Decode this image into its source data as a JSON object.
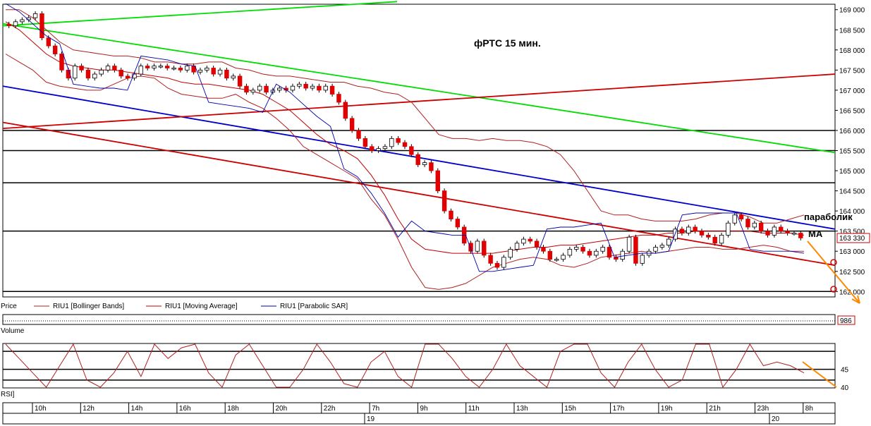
{
  "chart_data": {
    "type": "candlestick",
    "title": "фРТС   15 мин.",
    "price_axis": {
      "ylim": [
        161900,
        169100
      ],
      "ticks": [
        169000,
        168500,
        168000,
        167500,
        167000,
        166500,
        166000,
        165500,
        165000,
        164500,
        164000,
        163500,
        163000,
        162500,
        162000
      ],
      "tick_labels": [
        "169 000",
        "168 500",
        "168 000",
        "167 500",
        "167 000",
        "166 500",
        "166 000",
        "165 500",
        "165 000",
        "164 500",
        "164 000",
        "163 500",
        "163 000",
        "162 500",
        "162 000"
      ],
      "last_price": 163330,
      "last_price_label": "163 330"
    },
    "time_axis": {
      "labels": [
        "10h",
        "12h",
        "14h",
        "16h",
        "18h",
        "20h",
        "22h",
        "7h",
        "9h",
        "11h",
        "13h",
        "15h",
        "17h",
        "19h",
        "21h",
        "23h",
        "8h"
      ],
      "day_labels": [
        "19",
        "20"
      ]
    },
    "closes": [
      168600,
      168700,
      168750,
      168800,
      168900,
      168300,
      168100,
      167900,
      167500,
      167300,
      167600,
      167500,
      167300,
      167400,
      167500,
      167600,
      167500,
      167350,
      167300,
      167400,
      167600,
      167550,
      167600,
      167600,
      167550,
      167550,
      167500,
      167600,
      167450,
      167500,
      167550,
      167400,
      167500,
      167300,
      167350,
      167100,
      166950,
      167000,
      167100,
      166950,
      167000,
      167050,
      167000,
      167100,
      167150,
      167050,
      167100,
      167000,
      167100,
      166900,
      166700,
      166300,
      166000,
      165800,
      165600,
      165500,
      165550,
      165600,
      165800,
      165700,
      165600,
      165400,
      165150,
      165200,
      165000,
      164500,
      164000,
      163800,
      163600,
      163200,
      163000,
      163250,
      162900,
      162700,
      162600,
      162850,
      163050,
      163200,
      163300,
      163250,
      163100,
      163000,
      162800,
      162800,
      162900,
      163050,
      163100,
      163000,
      162900,
      163000,
      163100,
      162850,
      162800,
      163000,
      163350,
      162700,
      162900,
      163000,
      163100,
      163150,
      163300,
      163550,
      163450,
      163600,
      163500,
      163400,
      163350,
      163200,
      163400,
      163700,
      163900,
      163800,
      163600,
      163700,
      163500,
      163400,
      163600,
      163500,
      163450,
      163450,
      163330
    ],
    "bollinger_upper": [
      169000,
      169000,
      168800,
      168500,
      168200,
      168000,
      167950,
      167900,
      167850,
      167850,
      167800,
      167700,
      167700,
      167650,
      167650,
      167700,
      167700,
      167550,
      167500,
      167400,
      167350,
      167350,
      167300,
      167250,
      167200,
      167200,
      167100,
      167050,
      166950,
      166900,
      166700,
      166300,
      165900,
      165800,
      165800,
      165750,
      165800,
      165750,
      165750,
      165700,
      165600,
      165400,
      165000,
      164500,
      164000,
      163900,
      163900,
      163800,
      163750,
      163750,
      163750,
      163800,
      163900,
      163950,
      163950,
      163850,
      163700,
      163700,
      163800,
      163900
    ],
    "bollinger_lower": [
      167900,
      167700,
      167500,
      167200,
      167100,
      167050,
      167000,
      167000,
      167150,
      167300,
      167350,
      167300,
      167050,
      166900,
      166850,
      166800,
      166800,
      166900,
      166700,
      166550,
      166300,
      166000,
      165600,
      165400,
      165200,
      165000,
      164800,
      164300,
      163900,
      163300,
      162600,
      162100,
      162050,
      162100,
      162200,
      162400,
      162600,
      162700,
      162800,
      162850,
      162800,
      162650,
      162600,
      162700,
      162850,
      162900,
      162950,
      163000,
      162950,
      163000,
      163050,
      163100,
      163100,
      163050,
      163050,
      163100,
      163150,
      163100,
      163000,
      163000
    ],
    "moving_average": [
      168700,
      168500,
      168200,
      167900,
      167700,
      167600,
      167550,
      167500,
      167500,
      167450,
      167400,
      167350,
      167300,
      167200,
      167150,
      167150,
      167100,
      167050,
      167000,
      166900,
      166700,
      166500,
      166200,
      165900,
      165650,
      165500,
      165300,
      164900,
      164400,
      163800,
      163300,
      163050,
      163000,
      162950,
      162950,
      162950,
      162950,
      163000,
      163050,
      163100,
      163100,
      163150,
      163150,
      163200,
      163250,
      163300,
      163350,
      163400,
      163400,
      163450,
      163450,
      163500,
      163500,
      163500,
      163500,
      163500,
      163450,
      163450,
      163450,
      163400
    ],
    "trendlines": [
      {
        "color": "#00dd00",
        "from": [
          168650,
          "start"
        ],
        "to": [
          165450,
          "end"
        ],
        "kind": "falling"
      },
      {
        "color": "#00dd00",
        "from": [
          168600,
          "start"
        ],
        "to": [
          169200,
          "mid"
        ],
        "kind": "rising"
      },
      {
        "color": "#0000cc",
        "from": [
          167100,
          "start"
        ],
        "to": [
          163550,
          "end"
        ],
        "kind": "falling"
      },
      {
        "color": "#cc0000",
        "from": [
          166200,
          "start"
        ],
        "to": [
          162650,
          "end"
        ],
        "kind": "falling"
      },
      {
        "color": "#cc0000",
        "from": [
          166050,
          "start"
        ],
        "to": [
          167400,
          "end"
        ],
        "kind": "rising"
      }
    ],
    "horizontal_levels": [
      166000,
      165500,
      164700,
      163500,
      162000
    ],
    "annotations": {
      "parabolic": "параболик",
      "ma": "МА"
    },
    "legend": [
      "Price",
      "RIU1 [Bollinger Bands]",
      "RIU1 [Moving Average]",
      "RIU1 [Parabolic SAR]"
    ],
    "volume": {
      "label": "Volume",
      "last_value": "986"
    },
    "rsi": {
      "label": "RSI]",
      "ylim": [
        40,
        52
      ],
      "levels": [
        50,
        45,
        42
      ],
      "tick_labels": [
        "45",
        "40"
      ],
      "values": [
        60,
        48,
        44,
        38,
        46,
        52,
        42,
        36,
        44,
        50,
        43,
        58,
        48,
        51,
        56,
        44,
        40,
        49,
        53,
        46,
        38,
        40,
        45,
        52,
        47,
        41,
        36,
        47,
        50,
        43,
        38,
        60,
        53,
        48,
        43,
        38,
        45,
        52,
        46,
        43,
        38,
        50,
        58,
        54,
        44,
        40,
        47,
        52,
        45,
        38,
        42,
        56,
        54,
        40,
        45,
        52,
        46,
        47,
        46,
        44
      ]
    },
    "colors": {
      "bear": "#e00000",
      "bull": "#ffffff",
      "wick": "#000000",
      "bollinger": "#b02020",
      "ma": "#c00000",
      "sar": "#0000aa",
      "arrow": "#ff8800"
    }
  }
}
